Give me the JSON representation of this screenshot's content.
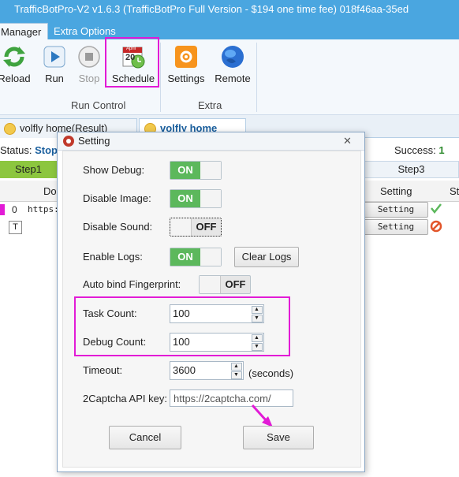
{
  "window": {
    "title": "TrafficBotPro-V2 v1.6.3 (TrafficBotPro Full Version - $194 one time fee) 018f46aa-35ed"
  },
  "ribbon": {
    "tabs": [
      {
        "label": "Manager"
      },
      {
        "label": "Extra Options"
      }
    ],
    "buttons": {
      "reload": "Reload",
      "run": "Run",
      "stop": "Stop",
      "schedule": "Schedule",
      "settings": "Settings",
      "remote": "Remote"
    },
    "groups": {
      "run_control": "Run Control",
      "extra": "Extra"
    },
    "schedule_calendar": {
      "month": "April",
      "day": "20"
    }
  },
  "doc_tabs": [
    {
      "label": "volfly home(Result)"
    },
    {
      "label": "volfly home"
    }
  ],
  "status_bar": {
    "status_label": "Status:",
    "status_value": "Stop",
    "success_label": "Success:",
    "success_value": "1"
  },
  "steps": {
    "step1": "Step1",
    "step3": "Step3"
  },
  "table": {
    "headers": {
      "domain": "Do",
      "setting": "Setting",
      "status": "Sta"
    },
    "rows": [
      {
        "index": "0",
        "url": "https:",
        "setting": "Setting"
      },
      {
        "index": "T",
        "url": "",
        "setting": "Setting"
      }
    ]
  },
  "dialog": {
    "title": "Setting",
    "show_debug": {
      "label": "Show Debug:",
      "state": "ON"
    },
    "disable_image": {
      "label": "Disable Image:",
      "state": "ON"
    },
    "disable_sound": {
      "label": "Disable Sound:",
      "state": "OFF"
    },
    "enable_logs": {
      "label": "Enable Logs:",
      "state": "ON",
      "clear_button": "Clear Logs"
    },
    "auto_bind": {
      "label": "Auto bind Fingerprint:",
      "state": "OFF"
    },
    "task_count": {
      "label": "Task Count:",
      "value": "100"
    },
    "debug_count": {
      "label": "Debug Count:",
      "value": "100"
    },
    "timeout": {
      "label": "Timeout:",
      "value": "3600",
      "unit": "(seconds)"
    },
    "captcha": {
      "label": "2Captcha API key:",
      "placeholder": "https://2captcha.com/"
    },
    "cancel": "Cancel",
    "save": "Save"
  },
  "colors": {
    "highlight": "#e21bd6",
    "title_bar": "#4aa6e0",
    "toggle_on": "#5cb85c"
  }
}
